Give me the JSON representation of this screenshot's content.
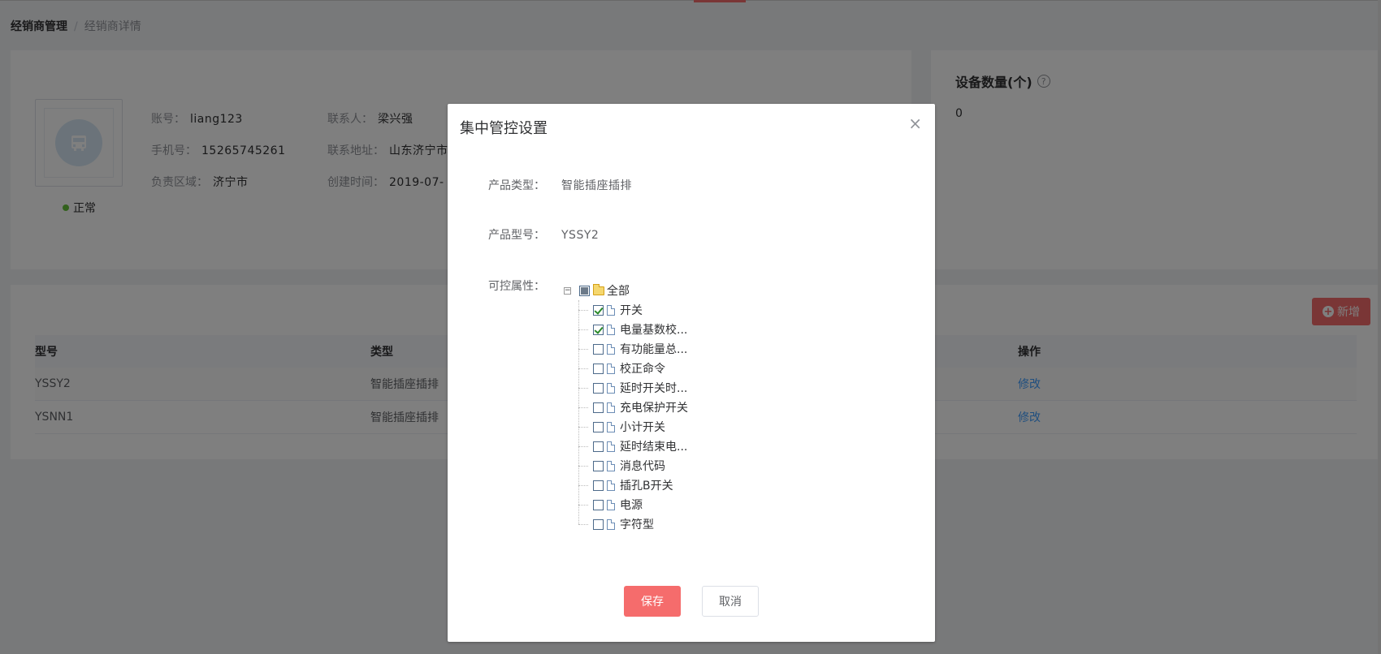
{
  "breadcrumb": {
    "parent": "经销商管理",
    "separator": "/",
    "current": "经销商详情"
  },
  "profile": {
    "status": "正常",
    "account_label": "账号：",
    "account": "liang123",
    "phone_label": "手机号：",
    "phone": "15265745261",
    "region_label": "负责区域：",
    "region": "济宁市",
    "contact_label": "联系人：",
    "contact": "梁兴强",
    "address_label": "联系地址：",
    "address": "山东济宁市",
    "created_label": "创建时间：",
    "created": "2019-07-"
  },
  "device": {
    "title": "设备数量(个)",
    "help": "?",
    "count": "0"
  },
  "table": {
    "add_label": "新增",
    "headers": {
      "model": "型号",
      "type": "类型",
      "op": "操作"
    },
    "rows": [
      {
        "model": "YSSY2",
        "type": "智能插座插排",
        "op": "修改"
      },
      {
        "model": "YSNN1",
        "type": "智能插座插排",
        "op": "修改"
      }
    ]
  },
  "dialog": {
    "title": "集中管控设置",
    "close": "×",
    "product_type_label": "产品类型：",
    "product_type": "智能插座插排",
    "product_model_label": "产品型号：",
    "product_model": "YSSY2",
    "attrs_label": "可控属性：",
    "tree_root": "全部",
    "tree_toggle": "−",
    "attributes": [
      {
        "label": "开关",
        "checked": true
      },
      {
        "label": "电量基数校...",
        "checked": true
      },
      {
        "label": "有功能量总...",
        "checked": false
      },
      {
        "label": "校正命令",
        "checked": false
      },
      {
        "label": "延时开关时...",
        "checked": false
      },
      {
        "label": "充电保护开关",
        "checked": false
      },
      {
        "label": "小计开关",
        "checked": false
      },
      {
        "label": "延时结束电...",
        "checked": false
      },
      {
        "label": "消息代码",
        "checked": false
      },
      {
        "label": "插孔B开关",
        "checked": false
      },
      {
        "label": "电源",
        "checked": false
      },
      {
        "label": "字符型",
        "checked": false
      }
    ],
    "save_label": "保存",
    "cancel_label": "取消"
  },
  "colors": {
    "accent": "#f56c6c",
    "link": "#409eff",
    "status_ok": "#67c23a"
  }
}
